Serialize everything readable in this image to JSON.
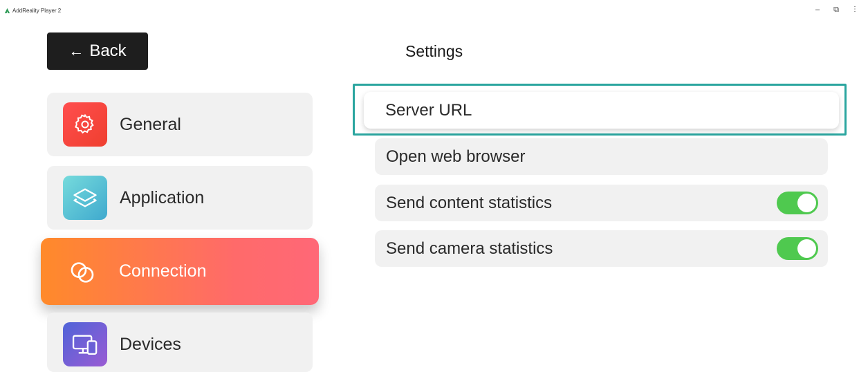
{
  "window": {
    "title": "AddReality Player 2",
    "controls": {
      "minimize": "–",
      "maximize": "⧉",
      "close": "⋮"
    }
  },
  "back_button": {
    "arrow": "←",
    "label": "Back"
  },
  "sidebar": {
    "items": [
      {
        "label": "General",
        "icon": "gear-icon",
        "selected": false
      },
      {
        "label": "Application",
        "icon": "layers-icon",
        "selected": false
      },
      {
        "label": "Connection",
        "icon": "link-icon",
        "selected": true
      },
      {
        "label": "Devices",
        "icon": "devices-icon",
        "selected": false
      }
    ]
  },
  "settings": {
    "title": "Settings",
    "rows": [
      {
        "label": "Server URL",
        "highlighted": true
      },
      {
        "label": "Open web browser"
      },
      {
        "label": "Send content statistics",
        "toggle": true,
        "enabled": true
      },
      {
        "label": "Send camera statistics",
        "toggle": true,
        "enabled": true
      }
    ]
  },
  "colors": {
    "highlight_border": "#2aa59f",
    "toggle_on": "#4fc94f",
    "connection_gradient_start": "#ff8a2a",
    "connection_gradient_end": "#ff6877",
    "back_button_bg": "#1e1e1e"
  }
}
